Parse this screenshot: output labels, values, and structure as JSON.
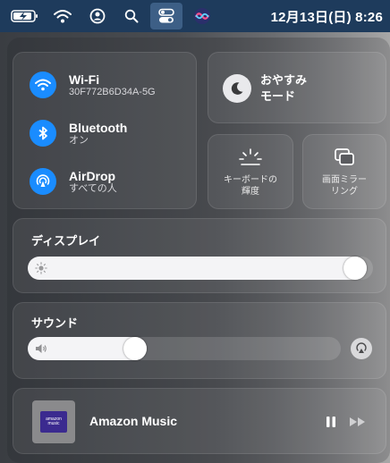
{
  "menubar": {
    "clock": "12月13日(日) 8:26"
  },
  "connectivity": {
    "wifi": {
      "title": "Wi-Fi",
      "subtitle": "30F772B6D34A-5G"
    },
    "bluetooth": {
      "title": "Bluetooth",
      "subtitle": "オン"
    },
    "airdrop": {
      "title": "AirDrop",
      "subtitle": "すべての人"
    }
  },
  "do_not_disturb": {
    "line1": "おやすみ",
    "line2": "モード"
  },
  "keyboard_brightness": {
    "line1": "キーボードの",
    "line2": "輝度"
  },
  "screen_mirroring": {
    "line1": "画面ミラー",
    "line2": "リング"
  },
  "display": {
    "label": "ディスプレイ",
    "level": 0.98
  },
  "sound": {
    "label": "サウンド",
    "level": 0.33
  },
  "now_playing": {
    "title": "Amazon Music",
    "art_line1": "amazon",
    "art_line2": "music"
  },
  "colors": {
    "accent_blue": "#1a8cff",
    "menubar": "#1e3b5c"
  }
}
